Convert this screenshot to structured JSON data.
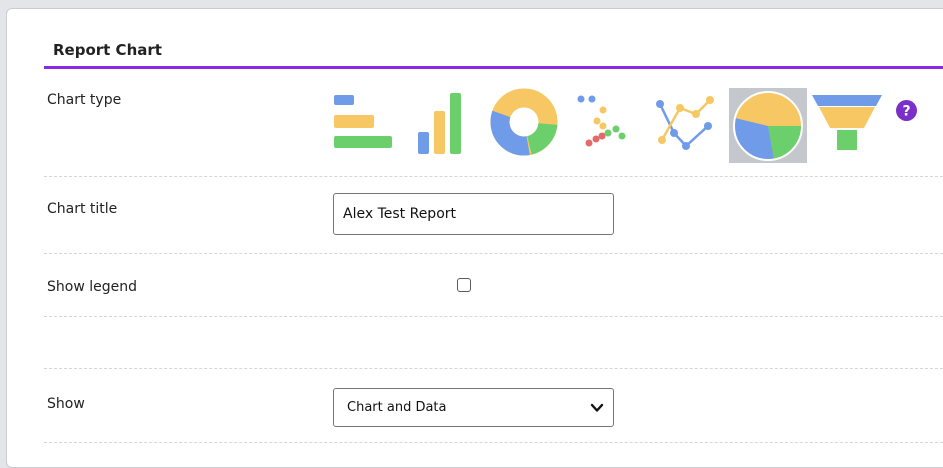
{
  "section": {
    "title": "Report Chart",
    "accent_color": "#8a2be2"
  },
  "chart_type": {
    "label": "Chart type",
    "options": [
      {
        "icon": "horizontal-bar-chart-icon",
        "selected": false
      },
      {
        "icon": "vertical-bar-chart-icon",
        "selected": false
      },
      {
        "icon": "doughnut-chart-icon",
        "selected": false
      },
      {
        "icon": "scatter-chart-icon",
        "selected": false
      },
      {
        "icon": "line-chart-icon",
        "selected": false
      },
      {
        "icon": "pie-chart-icon",
        "selected": true
      },
      {
        "icon": "funnel-chart-icon",
        "selected": false
      }
    ],
    "help_icon": "question-mark-icon",
    "help_glyph": "?"
  },
  "chart_title": {
    "label": "Chart title",
    "value": "Alex Test Report"
  },
  "show_legend": {
    "label": "Show legend",
    "checked": false
  },
  "show": {
    "label": "Show",
    "selected": "Chart and Data"
  }
}
